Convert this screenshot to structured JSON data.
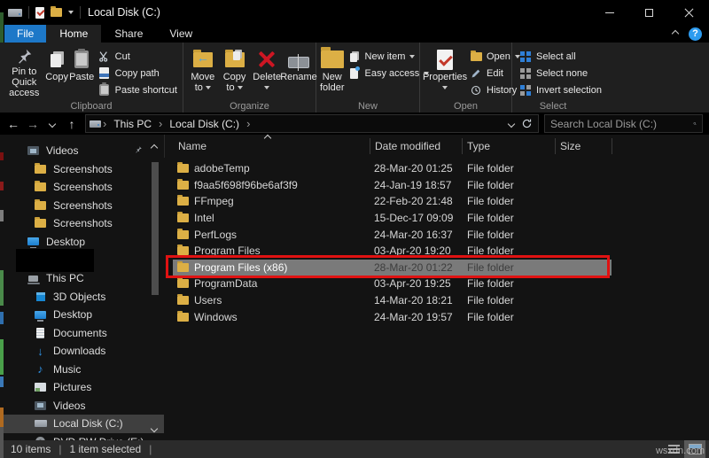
{
  "titlebar": {
    "title": "Local Disk (C:)"
  },
  "tabs": {
    "file": "File",
    "home": "Home",
    "share": "Share",
    "view": "View"
  },
  "ribbon": {
    "clipboard": {
      "label": "Clipboard",
      "pin": "Pin to Quick access",
      "copy": "Copy",
      "paste": "Paste",
      "cut": "Cut",
      "copy_path": "Copy path",
      "paste_shortcut": "Paste shortcut"
    },
    "organize": {
      "label": "Organize",
      "move_to": "Move to",
      "copy_to": "Copy to",
      "delete": "Delete",
      "rename": "Rename"
    },
    "new": {
      "label": "New",
      "new_folder": "New folder",
      "new_item": "New item",
      "easy_access": "Easy access"
    },
    "open": {
      "label": "Open",
      "properties": "Properties",
      "open": "Open",
      "edit": "Edit",
      "history": "History"
    },
    "select": {
      "label": "Select",
      "select_all": "Select all",
      "select_none": "Select none",
      "invert": "Invert selection"
    }
  },
  "address": {
    "crumb_root": "This PC",
    "crumb_current": "Local Disk (C:)",
    "crumb_sep": "›",
    "search_placeholder": "Search Local Disk (C:)"
  },
  "glyphs": {
    "back": "←",
    "forward": "→",
    "up": "↑",
    "downloads": "↓",
    "music": "♪",
    "help": "?"
  },
  "sidebar": {
    "items": [
      {
        "label": "Videos",
        "icon": "video",
        "indent": 1,
        "pinned": true
      },
      {
        "label": "Screenshots",
        "icon": "folder",
        "indent": 2
      },
      {
        "label": "Screenshots",
        "icon": "folder",
        "indent": 2
      },
      {
        "label": "Screenshots",
        "icon": "folder",
        "indent": 2
      },
      {
        "label": "Screenshots",
        "icon": "folder",
        "indent": 2
      },
      {
        "label": "Desktop",
        "icon": "desktop",
        "indent": 1
      },
      {
        "redacted": true
      },
      {
        "label": "This PC",
        "icon": "pc",
        "indent": 1
      },
      {
        "label": "3D Objects",
        "icon": "cube",
        "indent": 2
      },
      {
        "label": "Desktop",
        "icon": "desktop",
        "indent": 2
      },
      {
        "label": "Documents",
        "icon": "doc",
        "indent": 2
      },
      {
        "label": "Downloads",
        "icon": "download",
        "indent": 2,
        "glyph": "downloads"
      },
      {
        "label": "Music",
        "icon": "music",
        "indent": 2,
        "glyph": "music"
      },
      {
        "label": "Pictures",
        "icon": "picture",
        "indent": 2
      },
      {
        "label": "Videos",
        "icon": "video",
        "indent": 2
      },
      {
        "label": "Local Disk (C:)",
        "icon": "drive",
        "indent": 2,
        "selected": true
      },
      {
        "label": "DVD RW Drive (E:)",
        "icon": "disc",
        "indent": 2
      }
    ]
  },
  "list": {
    "columns": {
      "name": "Name",
      "date": "Date modified",
      "type": "Type",
      "size": "Size"
    },
    "rows": [
      {
        "name": "adobeTemp",
        "date": "28-Mar-20 01:25",
        "type": "File folder"
      },
      {
        "name": "f9aa5f698f96be6af3f9",
        "date": "24-Jan-19 18:57",
        "type": "File folder"
      },
      {
        "name": "FFmpeg",
        "date": "22-Feb-20 21:48",
        "type": "File folder"
      },
      {
        "name": "Intel",
        "date": "15-Dec-17 09:09",
        "type": "File folder"
      },
      {
        "name": "PerfLogs",
        "date": "24-Mar-20 16:37",
        "type": "File folder"
      },
      {
        "name": "Program Files",
        "date": "03-Apr-20 19:20",
        "type": "File folder"
      },
      {
        "name": "Program Files (x86)",
        "date": "28-Mar-20 01:22",
        "type": "File folder",
        "selected": true,
        "highlighted": true
      },
      {
        "name": "ProgramData",
        "date": "03-Apr-20 19:25",
        "type": "File folder"
      },
      {
        "name": "Users",
        "date": "14-Mar-20 18:21",
        "type": "File folder"
      },
      {
        "name": "Windows",
        "date": "24-Mar-20 19:57",
        "type": "File folder"
      }
    ]
  },
  "statusbar": {
    "count": "10 items",
    "selection": "1 item selected",
    "sep": "|"
  },
  "watermark": "wsxdn.com",
  "colors": {
    "accent": "#1d78c8",
    "selection": "#7a7a7a",
    "highlight_box": "#e01212",
    "folder": "#dcaf45"
  }
}
